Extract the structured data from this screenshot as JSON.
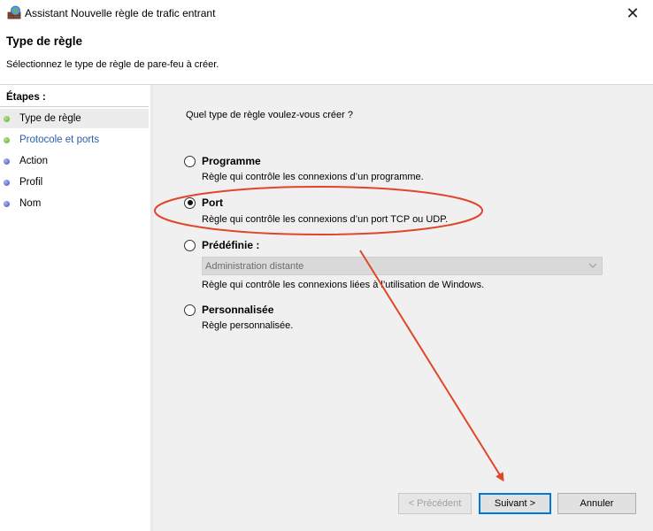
{
  "window": {
    "title": "Assistant Nouvelle règle de trafic entrant",
    "close_glyph": "✕",
    "icon": "firewall-icon"
  },
  "header": {
    "title": "Type de règle",
    "subtitle": "Sélectionnez le type de règle de pare-feu à créer."
  },
  "steps": {
    "heading": "Étapes :",
    "items": [
      {
        "label": "Type de règle",
        "state": "current"
      },
      {
        "label": "Protocole et ports",
        "state": "link"
      },
      {
        "label": "Action",
        "state": "pending"
      },
      {
        "label": "Profil",
        "state": "pending"
      },
      {
        "label": "Nom",
        "state": "pending"
      }
    ]
  },
  "main": {
    "question": "Quel type de règle voulez-vous créer ?",
    "options": [
      {
        "label": "Programme",
        "desc": "Règle qui contrôle les connexions d’un programme.",
        "checked": false
      },
      {
        "label": "Port",
        "desc": "Règle qui contrôle les connexions d’un port TCP ou UDP.",
        "checked": true
      },
      {
        "label": "Prédéfinie :",
        "desc": "Règle qui contrôle les connexions liées à l’utilisation de Windows.",
        "checked": false
      },
      {
        "label": "Personnalisée",
        "desc": "Règle personnalisée.",
        "checked": false
      }
    ],
    "predefined_select": {
      "value": "Administration distante",
      "disabled": true
    }
  },
  "buttons": {
    "previous": "< Précédent",
    "next": "Suivant >",
    "cancel": "Annuler"
  },
  "annotation_color": "#e0462a"
}
